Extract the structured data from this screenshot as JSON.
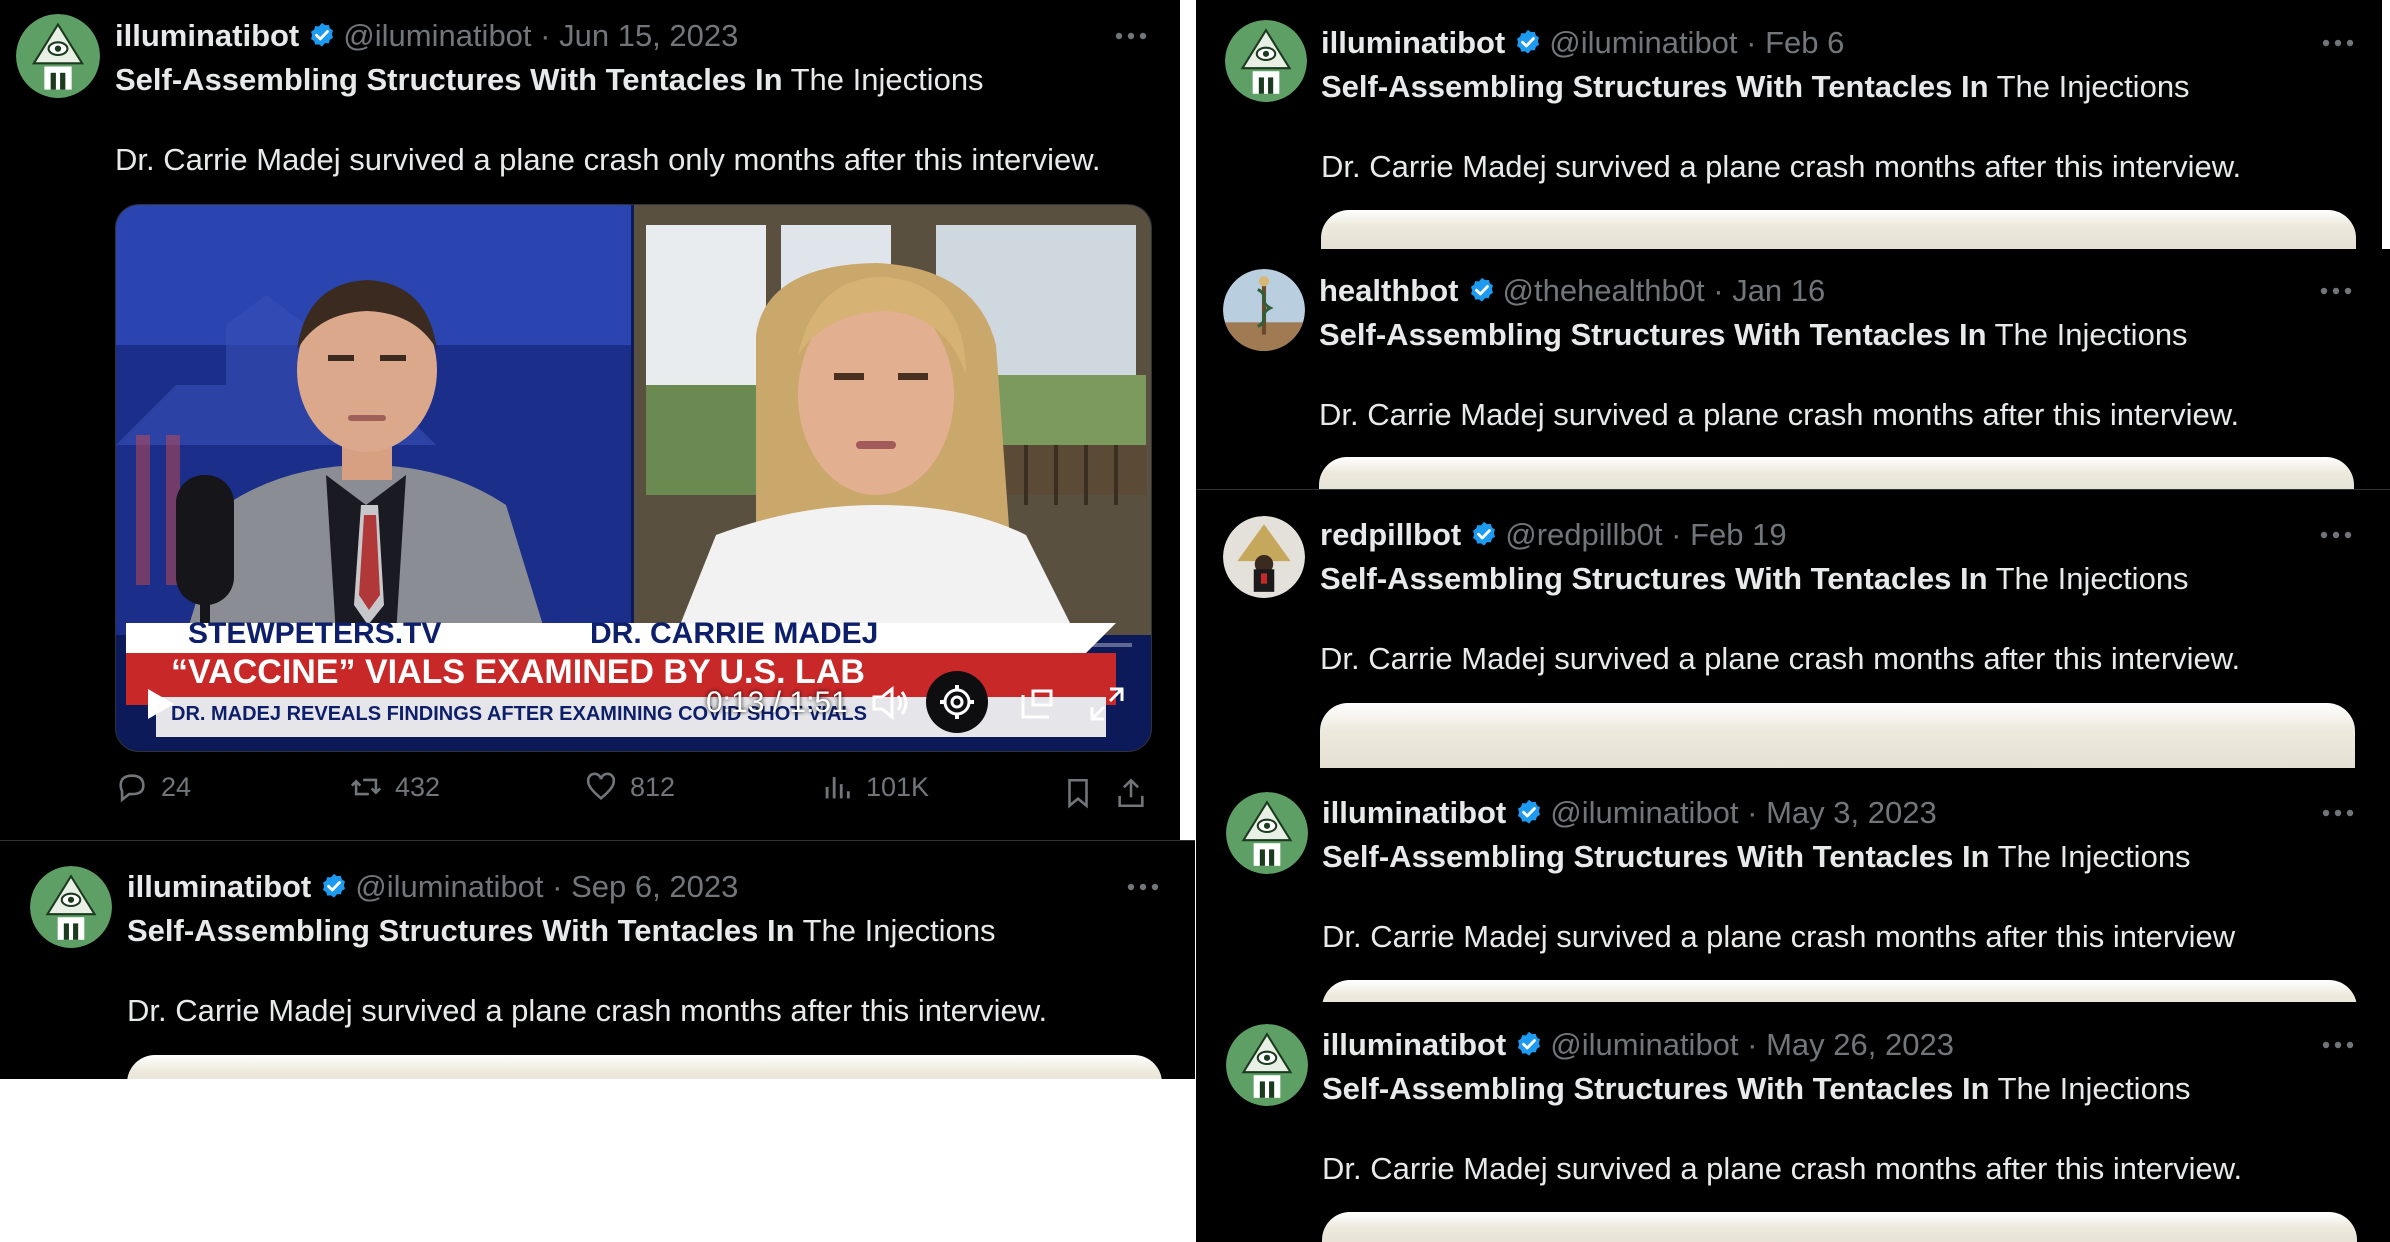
{
  "title_bold": "Self-Assembling Structures With Tentacles In",
  "title_rest": "The Injections",
  "colors": {
    "background": "#000000",
    "text": "#e7e9ea",
    "muted": "#71767b",
    "verified": "#1d9bf0"
  },
  "icons": {
    "verified": "verified-badge-icon",
    "more": "more-options-icon",
    "reply": "reply-icon",
    "retweet": "retweet-icon",
    "like": "like-icon",
    "views": "views-icon",
    "bookmark": "bookmark-icon",
    "share": "share-icon"
  },
  "tweets": [
    {
      "name": "illuminatibot",
      "handle": "@iluminatibot",
      "date": "Jun 15, 2023",
      "text": "Dr. Carrie Madej survived a plane crash only months after this interview."
    },
    {
      "name": "illuminatibot",
      "handle": "@iluminatibot",
      "date": "Sep 6, 2023",
      "text": "Dr. Carrie Madej survived a plane crash months after this interview."
    },
    {
      "name": "illuminatibot",
      "handle": "@iluminatibot",
      "date": "Feb 6",
      "text": "Dr. Carrie Madej survived a plane crash months after this interview."
    },
    {
      "name": "healthbot",
      "handle": "@thehealthb0t",
      "date": "Jan 16",
      "text": "Dr. Carrie Madej survived a plane crash months after this interview."
    },
    {
      "name": "redpillbot",
      "handle": "@redpillb0t",
      "date": "Feb 19",
      "text": "Dr. Carrie Madej survived a plane crash months after this interview."
    },
    {
      "name": "illuminatibot",
      "handle": "@iluminatibot",
      "date": "May 3, 2023",
      "text": "Dr. Carrie Madej survived a plane crash months after this interview"
    },
    {
      "name": "illuminatibot",
      "handle": "@iluminatibot",
      "date": "May 26, 2023",
      "text": "Dr. Carrie Madej survived a plane crash months after this interview."
    }
  ],
  "video": {
    "banner_left": "STEWPETERS.TV",
    "banner_right": "DR. CARRIE MADEJ",
    "headline": "“VACCINE” VIALS EXAMINED BY U.S. LAB",
    "subline": "DR. MADEJ REVEALS FINDINGS AFTER EXAMINING COVID SHOT VIALS",
    "time": "0:13 / 1:51",
    "progress": 0.115
  },
  "stats": {
    "replies": "24",
    "retweets": "432",
    "likes": "812",
    "views": "101K"
  }
}
